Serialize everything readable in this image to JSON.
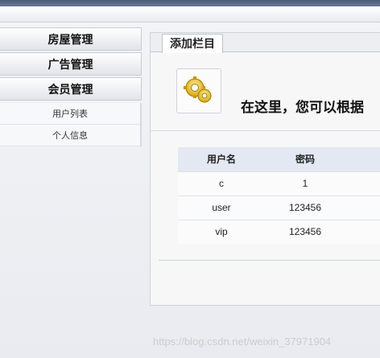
{
  "sidebar": {
    "menus": [
      {
        "label": "房屋管理"
      },
      {
        "label": "广告管理"
      },
      {
        "label": "会员管理"
      }
    ],
    "submenu": [
      {
        "label": "用户列表"
      },
      {
        "label": "个人信息"
      }
    ]
  },
  "main": {
    "tab_label": "添加栏目",
    "intro_text": "在这里，您可以根据",
    "icon": "gear-icon",
    "table": {
      "headers": [
        "用户名",
        "密码"
      ],
      "rows": [
        [
          "c",
          "1"
        ],
        [
          "user",
          "123456"
        ],
        [
          "vip",
          "123456"
        ]
      ]
    }
  },
  "watermark": "https://blog.csdn.net/weixin_37971904"
}
